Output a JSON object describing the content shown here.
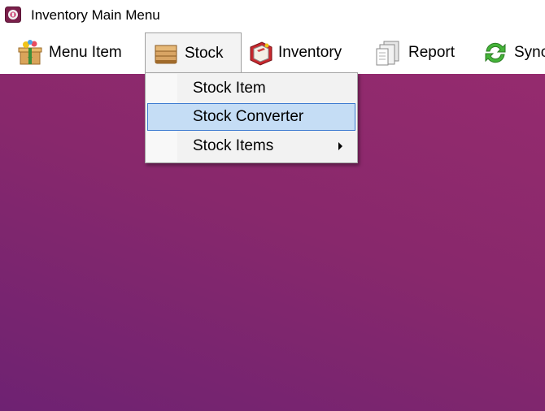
{
  "window": {
    "title": "Inventory Main Menu",
    "app_icon": "app-logo-icon"
  },
  "menubar": {
    "items": [
      {
        "label": "Menu Item",
        "icon": "gift-box-icon"
      },
      {
        "label": "Stock",
        "icon": "box-icon",
        "open": true
      },
      {
        "label": "Inventory",
        "icon": "book-icon"
      },
      {
        "label": "Report",
        "icon": "report-icon"
      },
      {
        "label": "Sync",
        "icon": "sync-icon"
      }
    ]
  },
  "dropdown": {
    "items": [
      {
        "label": "Stock Item",
        "highlighted": false,
        "has_submenu": false
      },
      {
        "label": "Stock Converter",
        "highlighted": true,
        "has_submenu": false
      },
      {
        "label": "Stock Items",
        "highlighted": false,
        "has_submenu": true
      }
    ]
  },
  "colors": {
    "canvas_top": "#952b6e",
    "canvas_bottom": "#6e2272",
    "highlight_bg": "#c5ddf5",
    "highlight_border": "#3d7bd1"
  }
}
